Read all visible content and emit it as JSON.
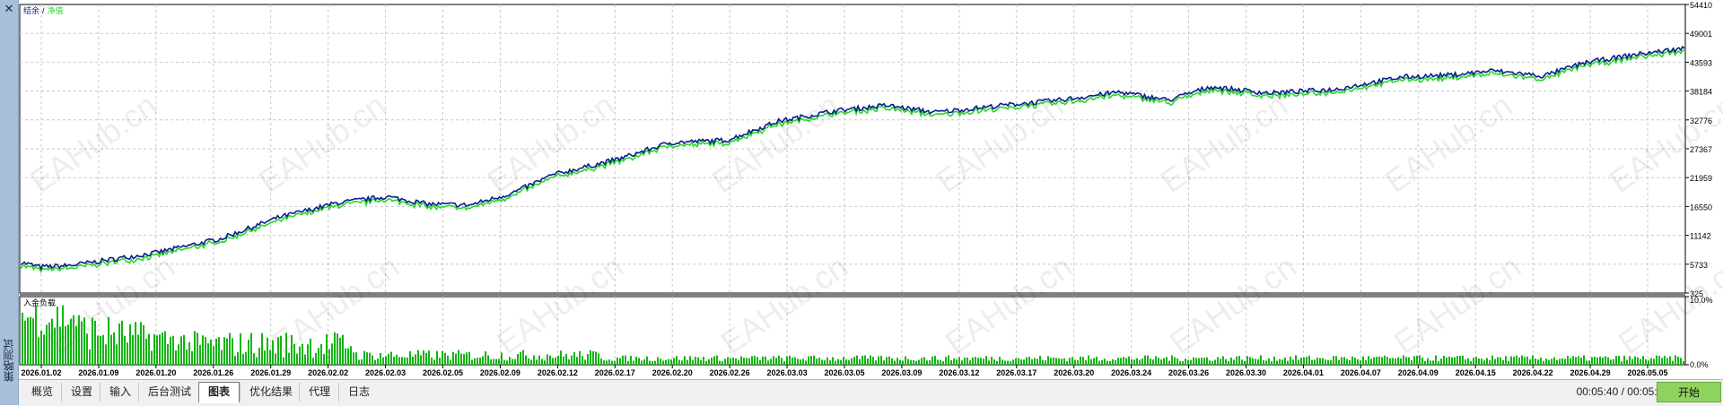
{
  "sidebar": {
    "close_glyph": "✕",
    "title": "策略测试"
  },
  "main_legend": {
    "balance": "结余",
    "separator": "/",
    "equity": "净值"
  },
  "sub_legend": {
    "label": "入金负载"
  },
  "watermark": "EAHub.cn",
  "colors": {
    "balance": "#0a1e8c",
    "equity": "#2bd62b",
    "load": "#11b511",
    "grid": "#c8c8c8",
    "accent_start": "#8fd35f"
  },
  "tabs": [
    {
      "label": "概览",
      "active": false
    },
    {
      "label": "设置",
      "active": false
    },
    {
      "label": "输入",
      "active": false
    },
    {
      "label": "后台测试",
      "active": false
    },
    {
      "label": "图表",
      "active": true
    },
    {
      "label": "优化结果",
      "active": false
    },
    {
      "label": "代理",
      "active": false
    },
    {
      "label": "日志",
      "active": false
    }
  ],
  "status": {
    "timer": "00:05:40 / 00:05:43",
    "start_label": "开始"
  },
  "chart_data": [
    {
      "type": "line",
      "title": "",
      "series": [
        {
          "name": "结余",
          "color": "#0a1e8c"
        },
        {
          "name": "净值",
          "color": "#2bd62b"
        }
      ],
      "ylim": [
        325,
        54410
      ],
      "yticks": [
        "54410",
        "49001",
        "43593",
        "38184",
        "32776",
        "27367",
        "21959",
        "16550",
        "11142",
        "5733",
        "325"
      ],
      "xticks": [
        "2026.01.02",
        "2026.01.09",
        "2026.01.20",
        "2026.01.26",
        "2026.01.29",
        "2026.02.02",
        "2026.02.03",
        "2026.02.05",
        "2026.02.09",
        "2026.02.12",
        "2026.02.17",
        "2026.02.20",
        "2026.02.26",
        "2026.03.03",
        "2026.03.05",
        "2026.03.09",
        "2026.03.12",
        "2026.03.17",
        "2026.03.20",
        "2026.03.24",
        "2026.03.26",
        "2026.03.30",
        "2026.04.01",
        "2026.04.07",
        "2026.04.09",
        "2026.04.15",
        "2026.04.22",
        "2026.04.29",
        "2026.05.05"
      ],
      "key_points": [
        {
          "t": 0.0,
          "y": 6100
        },
        {
          "t": 0.012,
          "y": 5200
        },
        {
          "t": 0.03,
          "y": 5500
        },
        {
          "t": 0.08,
          "y": 7800
        },
        {
          "t": 0.12,
          "y": 10500
        },
        {
          "t": 0.155,
          "y": 14500
        },
        {
          "t": 0.19,
          "y": 17200
        },
        {
          "t": 0.22,
          "y": 18400
        },
        {
          "t": 0.245,
          "y": 17000
        },
        {
          "t": 0.27,
          "y": 16800
        },
        {
          "t": 0.295,
          "y": 19000
        },
        {
          "t": 0.32,
          "y": 22500
        },
        {
          "t": 0.36,
          "y": 25500
        },
        {
          "t": 0.39,
          "y": 28500
        },
        {
          "t": 0.425,
          "y": 29000
        },
        {
          "t": 0.455,
          "y": 32500
        },
        {
          "t": 0.49,
          "y": 34500
        },
        {
          "t": 0.52,
          "y": 35500
        },
        {
          "t": 0.55,
          "y": 34200
        },
        {
          "t": 0.59,
          "y": 35500
        },
        {
          "t": 0.625,
          "y": 36500
        },
        {
          "t": 0.66,
          "y": 38000
        },
        {
          "t": 0.69,
          "y": 36500
        },
        {
          "t": 0.715,
          "y": 39000
        },
        {
          "t": 0.75,
          "y": 37800
        },
        {
          "t": 0.79,
          "y": 38500
        },
        {
          "t": 0.83,
          "y": 40800
        },
        {
          "t": 0.86,
          "y": 41200
        },
        {
          "t": 0.885,
          "y": 42000
        },
        {
          "t": 0.915,
          "y": 41000
        },
        {
          "t": 0.94,
          "y": 43500
        },
        {
          "t": 0.97,
          "y": 45000
        },
        {
          "t": 1.0,
          "y": 46200
        }
      ]
    },
    {
      "type": "bar",
      "title": "",
      "series": [
        {
          "name": "入金负载",
          "color": "#11b511"
        }
      ],
      "ylim": [
        0,
        10
      ],
      "yticks": [
        "10.0%",
        "0.0%"
      ],
      "unit": "%"
    }
  ]
}
